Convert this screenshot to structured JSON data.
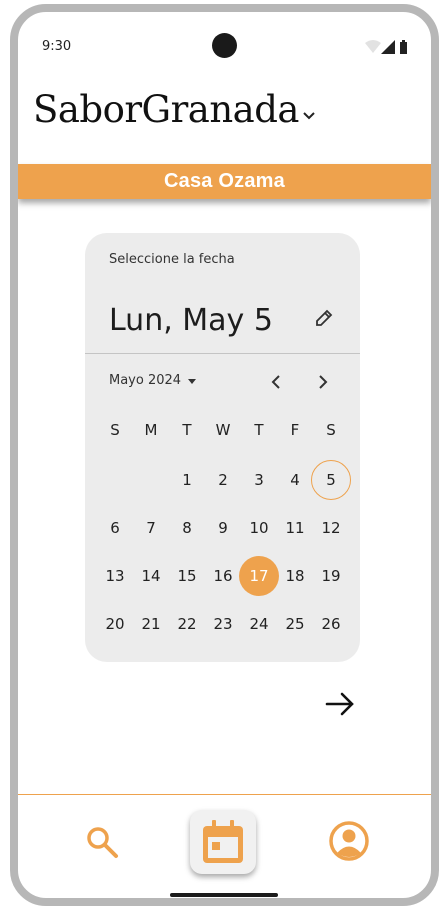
{
  "status_bar": {
    "time": "9:30"
  },
  "app": {
    "title": "SaborGranada"
  },
  "restaurant": {
    "name": "Casa Ozama"
  },
  "date_picker": {
    "heading": "Seleccione la fecha",
    "selected_date_text": "Lun, May 5",
    "month_label": "Mayo 2024",
    "weekdays": [
      "S",
      "M",
      "T",
      "W",
      "T",
      "F",
      "S"
    ],
    "days": [
      "",
      "",
      "1",
      "2",
      "3",
      "4",
      "5",
      "6",
      "7",
      "8",
      "9",
      "10",
      "11",
      "12",
      "13",
      "14",
      "15",
      "16",
      "17",
      "18",
      "19",
      "20",
      "21",
      "22",
      "23",
      "24",
      "25",
      "26"
    ],
    "today": "5",
    "selected": "17"
  },
  "icons": {
    "dropdown": "chevron-down-icon",
    "edit": "pencil-icon",
    "prev": "chevron-left-icon",
    "next": "chevron-right-icon",
    "continue": "arrow-right-icon",
    "search": "search-icon",
    "calendar": "calendar-icon",
    "profile": "account-circle-icon"
  },
  "colors": {
    "accent": "#eea24d",
    "picker_bg": "#ececec",
    "text": "#222222"
  }
}
